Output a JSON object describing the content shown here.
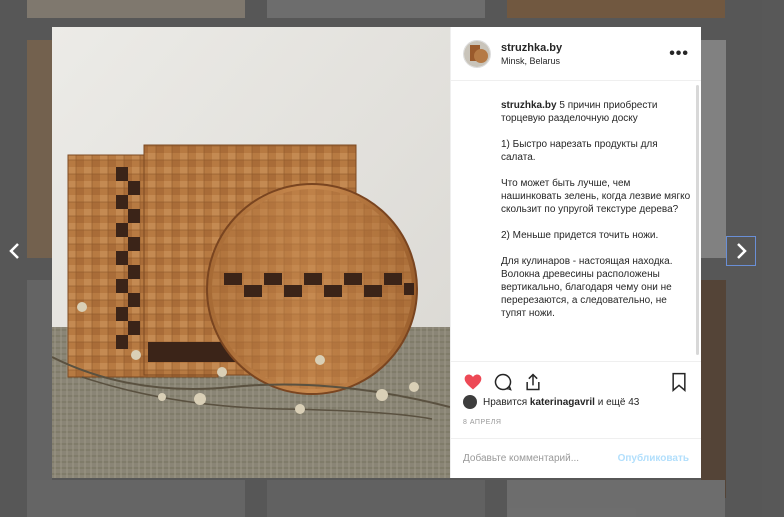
{
  "post": {
    "username": "struzhka.by",
    "location": "Minsk, Belarus",
    "more_label": "•••",
    "caption_user": "struzhka.by",
    "caption_paragraphs": [
      "5 причин приобрести торцевую разделочную доску",
      "1) Быстро нарезать продукты для салата.",
      "Что может быть лучше, чем нашинковать зелень, когда лезвие мягко скользит по упругой текстуре дерева?",
      "2) Меньше придется точить ножи.",
      "Для кулинаров - настоящая находка. Волокна древесины расположены вертикально, благодаря чему они не перерезаются, а следовательно, не тупят ножи."
    ],
    "likes_prefix": "Нравится",
    "likes_user": "katerinagavril",
    "likes_suffix": "и ещё 43",
    "date": "8 АПРЕЛЯ",
    "comment_placeholder": "Добавьте комментарий...",
    "publish_label": "Опубликовать"
  },
  "icons": {
    "like": "heart-icon",
    "comment": "comment-icon",
    "share": "share-icon",
    "save": "bookmark-icon",
    "prev": "chevron-left-icon",
    "next": "chevron-right-icon"
  },
  "colors": {
    "like": "#ed4956",
    "publish": "#b2dffc",
    "backdrop": "#5f5f5f"
  }
}
